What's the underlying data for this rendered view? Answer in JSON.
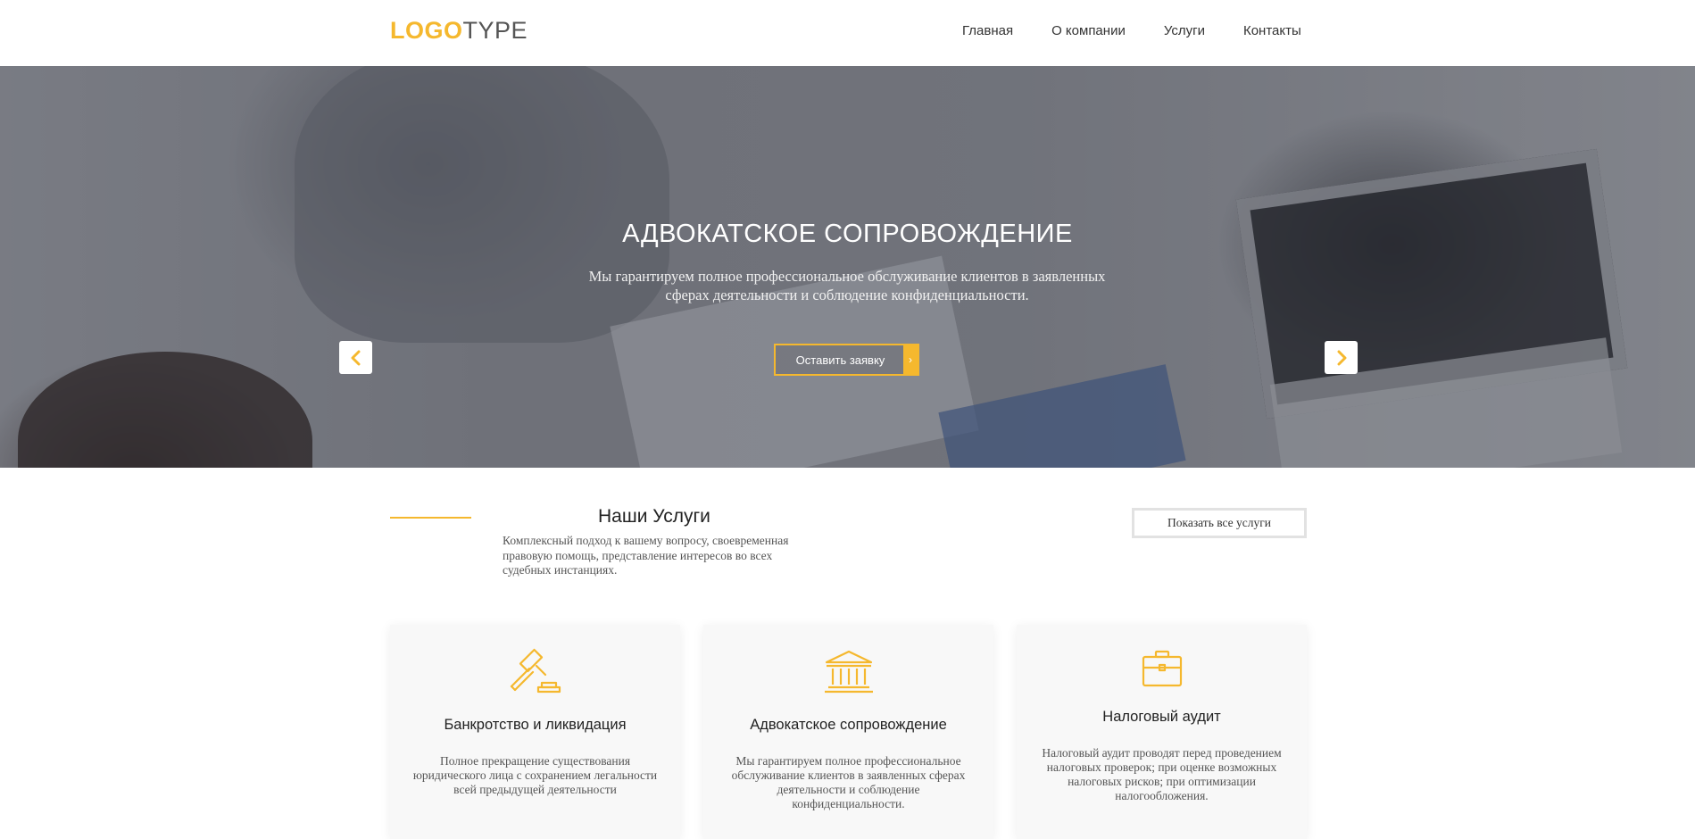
{
  "header": {
    "logo_part1": "LOGO",
    "logo_part2": "TYPE",
    "nav": [
      "Главная",
      "О компании",
      "Услуги",
      "Контакты"
    ]
  },
  "hero": {
    "title": "АДВОКАТСКОЕ СОПРОВОЖДЕНИЕ",
    "subtitle": "Мы гарантируем полное профессиональное обслуживание клиентов в заявленных сферах деятельности и соблюдение конфиденциальности.",
    "button_label": "Оставить заявку",
    "button_arrow": "›",
    "prev_icon": "chevron-left-icon",
    "next_icon": "chevron-right-icon"
  },
  "services": {
    "title": "Наши Услуги",
    "subtitle": "Комплексный подход к вашему вопросу, своевременная правовую помощь, представление интересов во всех судебных инстанциях.",
    "show_all": "Показать все услуги",
    "cards": [
      {
        "icon": "gavel-icon",
        "title": "Банкротство и ликвидация",
        "text": "Полное прекращение существования юридического лица с сохранением легальности всей предыдущей деятельности"
      },
      {
        "icon": "courthouse-icon",
        "title": "Адвокатское сопровождение",
        "text": "Мы гарантируем полное профессиональное обслуживание клиентов в заявленных сферах деятельности и соблюдение конфиденциальности."
      },
      {
        "icon": "briefcase-icon",
        "title": "Налоговый аудит",
        "text": "Налоговый аудит проводят перед проведением налоговых проверок; при оценке возможных налоговых рисков; при оптимизации налогообложения."
      }
    ]
  },
  "colors": {
    "accent": "#f5b82e",
    "text": "#222222",
    "card_bg": "#f8f8f8"
  }
}
